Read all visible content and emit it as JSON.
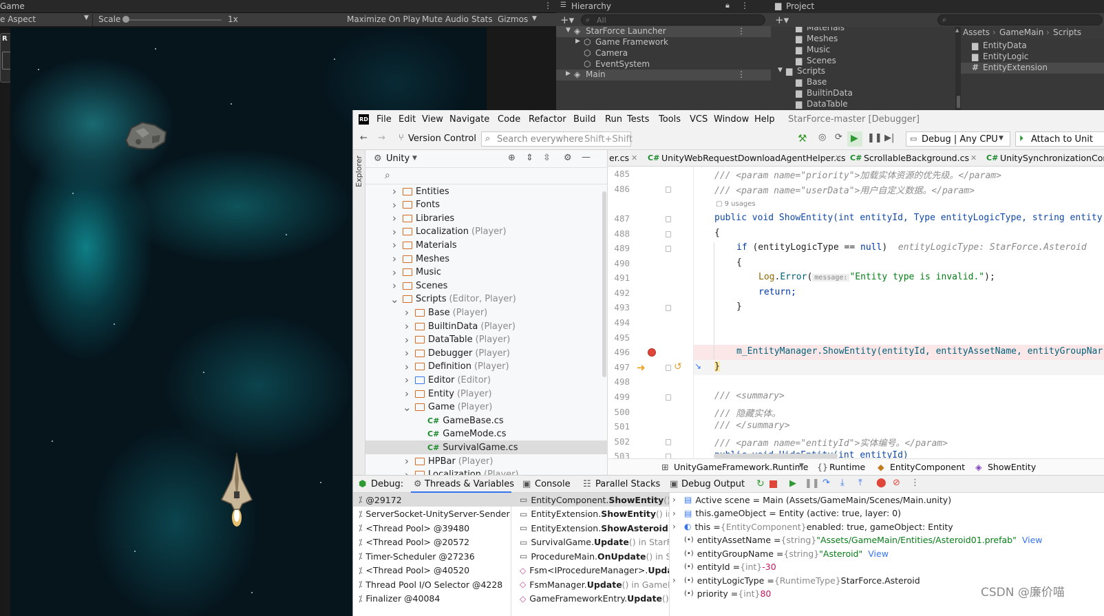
{
  "unity": {
    "game_tab": "Game",
    "aspect": "e Aspect",
    "scale_label": "Scale",
    "scale_value": "1x",
    "toolbar_buttons": [
      "Maximize On Play",
      "Mute Audio",
      "Stats",
      "Gizmos"
    ],
    "hierarchy": {
      "tab": "Hierarchy",
      "search_placeholder": "All",
      "root": "StarForce Launcher",
      "children": [
        "Game Framework",
        "Camera",
        "EventSystem"
      ],
      "main": "Main"
    },
    "project": {
      "tab": "Project",
      "folders": [
        "Materials",
        "Meshes",
        "Music",
        "Scenes",
        "Scripts",
        "Base",
        "BuiltinData",
        "DataTable"
      ],
      "breadcrumb": [
        "Assets",
        "GameMain",
        "Scripts"
      ],
      "files": [
        "EntityData",
        "EntityLogic",
        "EntityExtension"
      ]
    }
  },
  "rider": {
    "menu": [
      "File",
      "Edit",
      "View",
      "Navigate",
      "Code",
      "Refactor",
      "Build",
      "Run",
      "Tests",
      "Tools",
      "VCS",
      "Window",
      "Help"
    ],
    "project_title": "StarForce-master [Debugger]",
    "version_control": "Version Control",
    "search_placeholder": "Search everywhere",
    "search_shortcut": "Shift+Shift",
    "run_config": "Debug | Any CPU",
    "attach": "Attach to Unit",
    "explorer_label": "Explorer",
    "explorer_view": "Unity",
    "tree": [
      {
        "label": "Entities",
        "suffix": ""
      },
      {
        "label": "Fonts",
        "suffix": ""
      },
      {
        "label": "Libraries",
        "suffix": ""
      },
      {
        "label": "Localization",
        "suffix": "(Player)"
      },
      {
        "label": "Materials",
        "suffix": ""
      },
      {
        "label": "Meshes",
        "suffix": ""
      },
      {
        "label": "Music",
        "suffix": ""
      },
      {
        "label": "Scenes",
        "suffix": ""
      },
      {
        "label": "Scripts",
        "suffix": "(Editor, Player)"
      },
      {
        "label": "Base",
        "suffix": "(Player)"
      },
      {
        "label": "BuiltinData",
        "suffix": "(Player)"
      },
      {
        "label": "DataTable",
        "suffix": "(Player)"
      },
      {
        "label": "Debugger",
        "suffix": "(Player)"
      },
      {
        "label": "Definition",
        "suffix": "(Player)"
      },
      {
        "label": "Editor",
        "suffix": "(Editor)"
      },
      {
        "label": "Entity",
        "suffix": "(Player)"
      },
      {
        "label": "Game",
        "suffix": "(Player)"
      },
      {
        "label": "GameBase.cs",
        "suffix": ""
      },
      {
        "label": "GameMode.cs",
        "suffix": ""
      },
      {
        "label": "SurvivalGame.cs",
        "suffix": ""
      },
      {
        "label": "HPBar",
        "suffix": "(Player)"
      },
      {
        "label": "Localization",
        "suffix": "(Player)"
      }
    ],
    "editor_tabs": [
      "er.cs",
      "UnityWebRequestDownloadAgentHelper.cs",
      "ScrollableBackground.cs",
      "UnitySynchronizationContex"
    ],
    "code": {
      "l485": "/// <param name=\"priority\">加载实体资源的优先级。</param>",
      "l486": "/// <param name=\"userData\">用户自定义数据。</param>",
      "usages": "9 usages",
      "l487": "public void ShowEntity(int entityId, Type entityLogicType, string entity",
      "l489_hint": "entityLogicType: StarForce.Asteroid",
      "l491_hint": "message:",
      "l491_str": "\"Entity type is invalid.\"",
      "l495": "m_EntityManager.ShowEntity(entityId, entityAssetName, entityGroupNar",
      "l498": "/// <summary>",
      "l499": "/// 隐藏实体。",
      "l500": "/// </summary>",
      "l501": "/// <param name=\"entityId\">实体编号。</param>",
      "l502": "public void HideEntity(int entityId)",
      "line_numbers": [
        "485",
        "486",
        "487",
        "488",
        "489",
        "490",
        "491",
        "492",
        "493",
        "494",
        "495",
        "496",
        "497",
        "498",
        "499",
        "500",
        "501",
        "502",
        "503"
      ]
    },
    "breadcrumb": [
      "UnityGameFramework.Runtime",
      "Runtime",
      "EntityComponent",
      "ShowEntity"
    ],
    "debug_tabs": [
      "Debug:",
      "Threads & Variables",
      "Console",
      "Parallel Stacks",
      "Debug Output"
    ],
    "threads": [
      "@29172",
      "ServerSocket-UnityServer-Sender @",
      "<Thread Pool> @39480",
      "<Thread Pool> @20572",
      "Timer-Scheduler @27236",
      "<Thread Pool> @40520",
      "Thread Pool I/O Selector @4228",
      "Finalizer @40084"
    ],
    "frames": [
      {
        "cls": "EntityComponent.",
        "method": "ShowEntity",
        "rest": "() in U"
      },
      {
        "cls": "EntityExtension.",
        "method": "ShowEntity",
        "rest": "() in Star"
      },
      {
        "cls": "EntityExtension.",
        "method": "ShowAsteroid",
        "rest": "() in S"
      },
      {
        "cls": "SurvivalGame.",
        "method": "Update",
        "rest": "() in StarForce"
      },
      {
        "cls": "ProcedureMain.",
        "method": "OnUpdate",
        "rest": "() in Star"
      },
      {
        "cls": "Fsm<IProcedureManager>.",
        "method": "Update",
        "rest": ""
      },
      {
        "cls": "FsmManager.",
        "method": "Update",
        "rest": "() in GameFrar"
      },
      {
        "cls": "GameFrameworkEntry.",
        "method": "Update",
        "rest": "() in"
      }
    ],
    "variables": [
      {
        "name": "Active scene = Main (Assets/GameMain/Scenes/Main.unity)",
        "type": "",
        "value": "",
        "link": ""
      },
      {
        "name": "this.gameObject = Entity (active: true, layer: 0)",
        "type": "",
        "value": "",
        "link": ""
      },
      {
        "name": "this = ",
        "type": "{EntityComponent}",
        "value": " enabled: true, gameObject: Entity",
        "link": ""
      },
      {
        "name": "entityAssetName = ",
        "type": "{string}",
        "value": " \"Assets/GameMain/Entities/Asteroid01.prefab\"",
        "link": "View"
      },
      {
        "name": "entityGroupName = ",
        "type": "{string}",
        "value": " \"Asteroid\"",
        "link": "View"
      },
      {
        "name": "entityId = ",
        "type": "{int}",
        "value": " -30",
        "link": ""
      },
      {
        "name": "entityLogicType = ",
        "type": "{RuntimeType}",
        "value": " StarForce.Asteroid",
        "link": ""
      },
      {
        "name": "priority = ",
        "type": "{int}",
        "value": " 80",
        "link": ""
      }
    ]
  },
  "watermark": "CSDN @廉价喵"
}
